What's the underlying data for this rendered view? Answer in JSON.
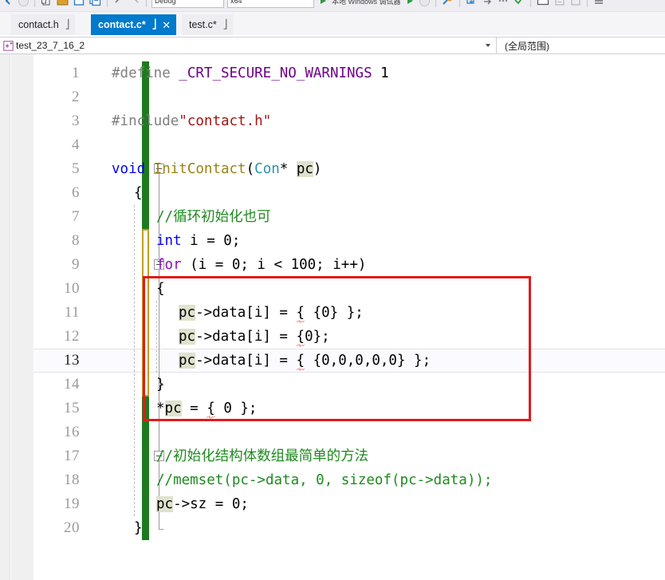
{
  "window": {
    "app": "Visual Studio",
    "toolbar": {
      "config_combo": "Debug",
      "platform_combo": "x64",
      "target_text": "本地 Windows 调试器",
      "icons": [
        "back-navigate-icon",
        "forward-navigate-icon",
        "new-file-icon",
        "open-file-icon",
        "save-icon",
        "save-all-icon",
        "undo-icon",
        "redo-icon",
        "start-debug-icon",
        "stop-icon",
        "hot-reload-icon",
        "step-into-icon",
        "step-over-icon",
        "step-out-icon",
        "window-layout-icon",
        "comment-icon"
      ]
    }
  },
  "tabs": [
    {
      "label": "contact.h",
      "active": false,
      "dirty": false,
      "pinned": true,
      "closable": false
    },
    {
      "label": "contact.c*",
      "active": true,
      "dirty": true,
      "pinned": true,
      "closable": true
    },
    {
      "label": "test.c*",
      "active": false,
      "dirty": true,
      "pinned": true,
      "closable": false
    }
  ],
  "navbar": {
    "project_icon": "project-cpp-icon",
    "project": "test_23_7_16_2",
    "scope": "(全局范围)"
  },
  "editor": {
    "current_line": 13,
    "total_lines_shown": 20,
    "lines": [
      {
        "n": 1,
        "tokens": [
          {
            "t": "#define ",
            "c": "t-pre"
          },
          {
            "t": "_CRT_SECURE_NO_WARNINGS",
            "c": "t-macro"
          },
          {
            "t": " 1",
            "c": "t-num"
          }
        ]
      },
      {
        "n": 2,
        "tokens": []
      },
      {
        "n": 3,
        "tokens": [
          {
            "t": "#include",
            "c": "t-pre"
          },
          {
            "t": "\"contact.h\"",
            "c": "t-str"
          }
        ]
      },
      {
        "n": 4,
        "tokens": []
      },
      {
        "n": 5,
        "tokens": [
          {
            "t": "void",
            "c": "t-kw"
          },
          {
            "t": " ",
            "c": "t-plain"
          },
          {
            "t": "InitContact",
            "c": "t-fn"
          },
          {
            "t": "(",
            "c": "t-plain"
          },
          {
            "t": "Con",
            "c": "t-type"
          },
          {
            "t": "* ",
            "c": "t-plain"
          },
          {
            "t": "pc",
            "c": "t-plain hl"
          },
          {
            "t": ")",
            "c": "t-plain"
          }
        ]
      },
      {
        "n": 6,
        "tokens": [
          {
            "t": "{",
            "c": "t-plain"
          }
        ],
        "indent": 1
      },
      {
        "n": 7,
        "tokens": [
          {
            "t": "//循环初始化也可",
            "c": "t-cmt"
          }
        ],
        "indent": 2
      },
      {
        "n": 8,
        "tokens": [
          {
            "t": "int",
            "c": "t-kw"
          },
          {
            "t": " i = 0;",
            "c": "t-plain"
          }
        ],
        "indent": 2
      },
      {
        "n": 9,
        "tokens": [
          {
            "t": "for",
            "c": "t-ctl"
          },
          {
            "t": " (i = 0; i < 100; i++)",
            "c": "t-plain"
          }
        ],
        "indent": 2
      },
      {
        "n": 10,
        "tokens": [
          {
            "t": "{",
            "c": "t-plain"
          }
        ],
        "indent": 2
      },
      {
        "n": 11,
        "tokens": [
          {
            "t": "pc",
            "c": "t-plain hl"
          },
          {
            "t": "->data[i] = ",
            "c": "t-plain"
          },
          {
            "t": "{",
            "c": "t-plain squig"
          },
          {
            "t": " {0} };",
            "c": "t-plain"
          }
        ],
        "indent": 3
      },
      {
        "n": 12,
        "tokens": [
          {
            "t": "pc",
            "c": "t-plain hl"
          },
          {
            "t": "->data[i] = ",
            "c": "t-plain"
          },
          {
            "t": "{",
            "c": "t-plain squig"
          },
          {
            "t": "0};",
            "c": "t-plain"
          }
        ],
        "indent": 3
      },
      {
        "n": 13,
        "tokens": [
          {
            "t": "pc",
            "c": "t-plain hl"
          },
          {
            "t": "->data[i] = ",
            "c": "t-plain"
          },
          {
            "t": "{",
            "c": "t-plain squig"
          },
          {
            "t": " {0,0,0,0,0} };",
            "c": "t-plain"
          }
        ],
        "indent": 3
      },
      {
        "n": 14,
        "tokens": [
          {
            "t": "}",
            "c": "t-plain"
          }
        ],
        "indent": 2
      },
      {
        "n": 15,
        "tokens": [
          {
            "t": "*",
            "c": "t-plain"
          },
          {
            "t": "pc",
            "c": "t-plain hl"
          },
          {
            "t": " = ",
            "c": "t-plain"
          },
          {
            "t": "{",
            "c": "t-plain squig"
          },
          {
            "t": " 0 };",
            "c": "t-plain"
          }
        ],
        "indent": 2
      },
      {
        "n": 16,
        "tokens": []
      },
      {
        "n": 17,
        "tokens": [
          {
            "t": "//初始化结构体数组最简单的方法",
            "c": "t-cmt"
          }
        ],
        "indent": 2
      },
      {
        "n": 18,
        "tokens": [
          {
            "t": "//memset(pc->data, 0, sizeof(pc->data));",
            "c": "t-cmt"
          }
        ],
        "indent": 2
      },
      {
        "n": 19,
        "tokens": [
          {
            "t": "pc",
            "c": "t-plain hl"
          },
          {
            "t": "->sz = 0;",
            "c": "t-plain"
          }
        ],
        "indent": 2
      },
      {
        "n": 20,
        "tokens": [
          {
            "t": "}",
            "c": "t-plain"
          }
        ],
        "indent": 1
      }
    ],
    "change_bars": [
      {
        "kind": "saved",
        "from_line": 1,
        "to_line": 7
      },
      {
        "kind": "unsaved",
        "from_line": 8,
        "to_line": 14
      },
      {
        "kind": "saved",
        "from_line": 15,
        "to_line": 20
      }
    ],
    "collapse_toggles": [
      5,
      9,
      17
    ],
    "annotation_box": {
      "from_line": 10,
      "to_line": 15,
      "color": "#e01b1b"
    }
  },
  "colors": {
    "tab_active": "#007acc",
    "change_saved": "#1f7a1f",
    "change_unsaved": "#c79a21",
    "annotation_red": "#e01b1b",
    "comment_green": "#1e8a1e",
    "keyword_blue": "#0000ff",
    "control_purple": "#8f08c4",
    "macro_purple": "#6f008a",
    "string_red": "#a31515",
    "type_cyan": "#2b91af",
    "function_olive": "#9b8211",
    "preproc_gray": "#808080",
    "highlight_bg": "#dfe2cc"
  }
}
